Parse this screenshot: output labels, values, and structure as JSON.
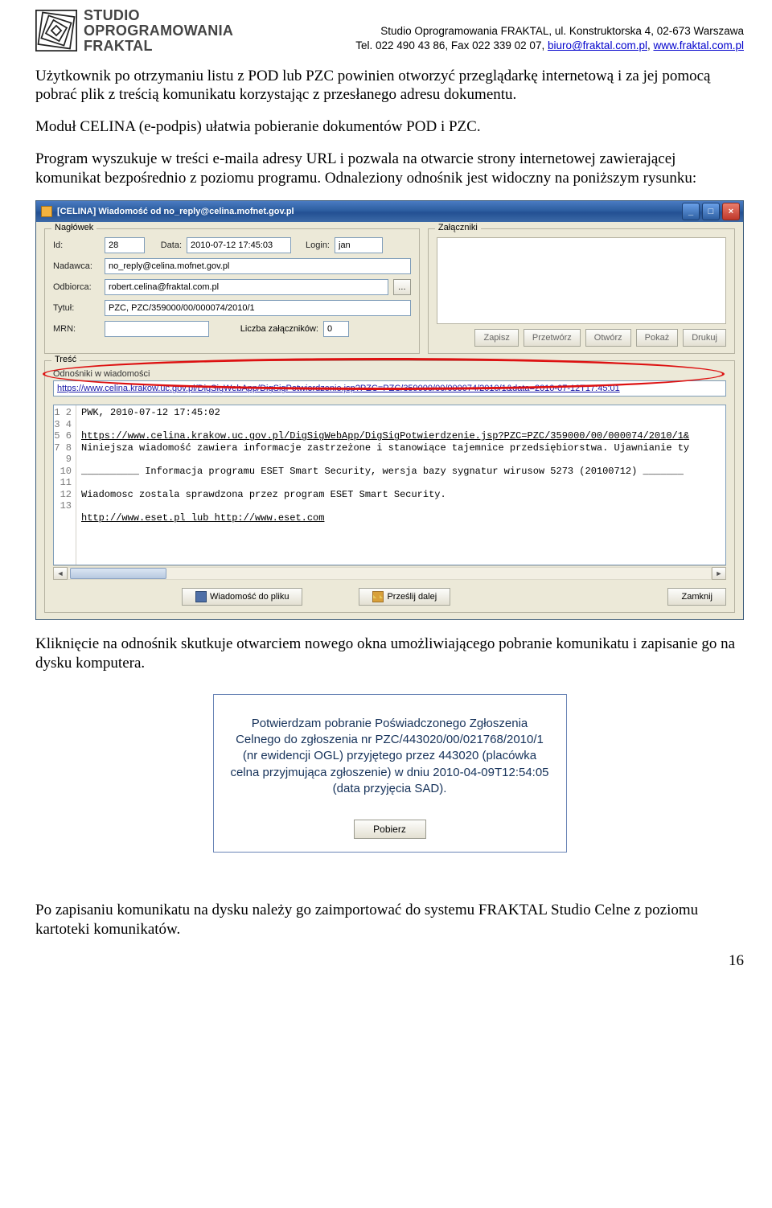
{
  "header": {
    "logo_lines": [
      "STUDIO",
      "OPROGRAMOWANIA",
      "FRAKTAL"
    ],
    "addr_line1": "Studio Oprogramowania FRAKTAL, ul. Konstruktorska 4, 02-673 Warszawa",
    "addr_line2_pre": "Tel. 022 490 43 86, Fax 022 339 02 07, ",
    "email": "biuro@fraktal.com.pl",
    "sep": ", ",
    "site": "www.fraktal.com.pl"
  },
  "para1": "Użytkownik po otrzymaniu listu z POD lub PZC powinien otworzyć przeglądarkę internetową i za jej pomocą pobrać plik z treścią komunikatu korzystając z przesłanego adresu dokumentu.",
  "para2": "Moduł CELINA (e-podpis) ułatwia pobieranie dokumentów POD i PZC.",
  "para3": "Program wyszukuje w treści e-maila adresy URL i pozwala na otwarcie strony internetowej zawierającej komunikat bezpośrednio z poziomu programu. Odnaleziony odnośnik jest widoczny na poniższym rysunku:",
  "window": {
    "title": "[CELINA] Wiadomość od no_reply@celina.mofnet.gov.pl",
    "naglowek": {
      "legend": "Nagłówek",
      "id_label": "Id:",
      "id_value": "28",
      "data_label": "Data:",
      "data_value": "2010-07-12 17:45:03",
      "login_label": "Login:",
      "login_value": "jan",
      "nadawca_label": "Nadawca:",
      "nadawca_value": "no_reply@celina.mofnet.gov.pl",
      "odbiorca_label": "Odbiorca:",
      "odbiorca_value": "robert.celina@fraktal.com.pl",
      "tytul_label": "Tytuł:",
      "tytul_value": "PZC, PZC/359000/00/000074/2010/1",
      "mrn_label": "MRN:",
      "mrn_value": "",
      "liczba_label": "Liczba załączników:",
      "liczba_value": "0"
    },
    "zalaczniki": {
      "legend": "Załączniki",
      "zapisz": "Zapisz",
      "przetworz": "Przetwórz",
      "otworz": "Otwórz",
      "pokaz": "Pokaż",
      "drukuj": "Drukuj"
    },
    "tresc": {
      "legend": "Treść",
      "odnosniki_label": "Odnośniki w wiadomości",
      "link": "https://www.celina.krakow.uc.gov.pl/DigSigWebApp/DigSigPotwierdzenie.jsp?PZC=PZC/359000/00/000074/2010/1&data=2010-07-12T17:45:01",
      "lines": [
        "PWK, 2010-07-12 17:45:02",
        "",
        "https://www.celina.krakow.uc.gov.pl/DigSigWebApp/DigSigPotwierdzenie.jsp?PZC=PZC/359000/00/000074/2010/1&",
        "Niniejsza wiadomość zawiera informacje zastrzeżone i stanowiące tajemnice przedsiębiorstwa. Ujawnianie ty",
        "",
        "__________ Informacja programu ESET Smart Security, wersja bazy sygnatur wirusow 5273 (20100712) _______",
        "",
        "Wiadomosc zostala sprawdzona przez program ESET Smart Security.",
        "",
        "http://www.eset.pl lub http://www.eset.com",
        "",
        "",
        ""
      ]
    },
    "bottom": {
      "wiadomosc": "Wiadomość do pliku",
      "przeslij": "Prześlij dalej",
      "zamknij": "Zamknij"
    }
  },
  "para4": "Kliknięcie na odnośnik skutkuje otwarciem nowego okna umożliwiającego pobranie komunikatu i zapisanie go na dysku komputera.",
  "browser": {
    "text": "Potwierdzam pobranie Poświadczonego Zgłoszenia Celnego do zgłoszenia nr PZC/443020/00/021768/2010/1 (nr ewidencji OGL) przyjętego przez 443020 (placówka celna przyjmująca zgłoszenie) w dniu 2010-04-09T12:54:05 (data przyjęcia SAD).",
    "pobierz": "Pobierz"
  },
  "para5": "Po zapisaniu komunikatu na dysku należy go zaimportować do systemu FRAKTAL Studio Celne z poziomu kartoteki komunikatów.",
  "page_number": "16"
}
